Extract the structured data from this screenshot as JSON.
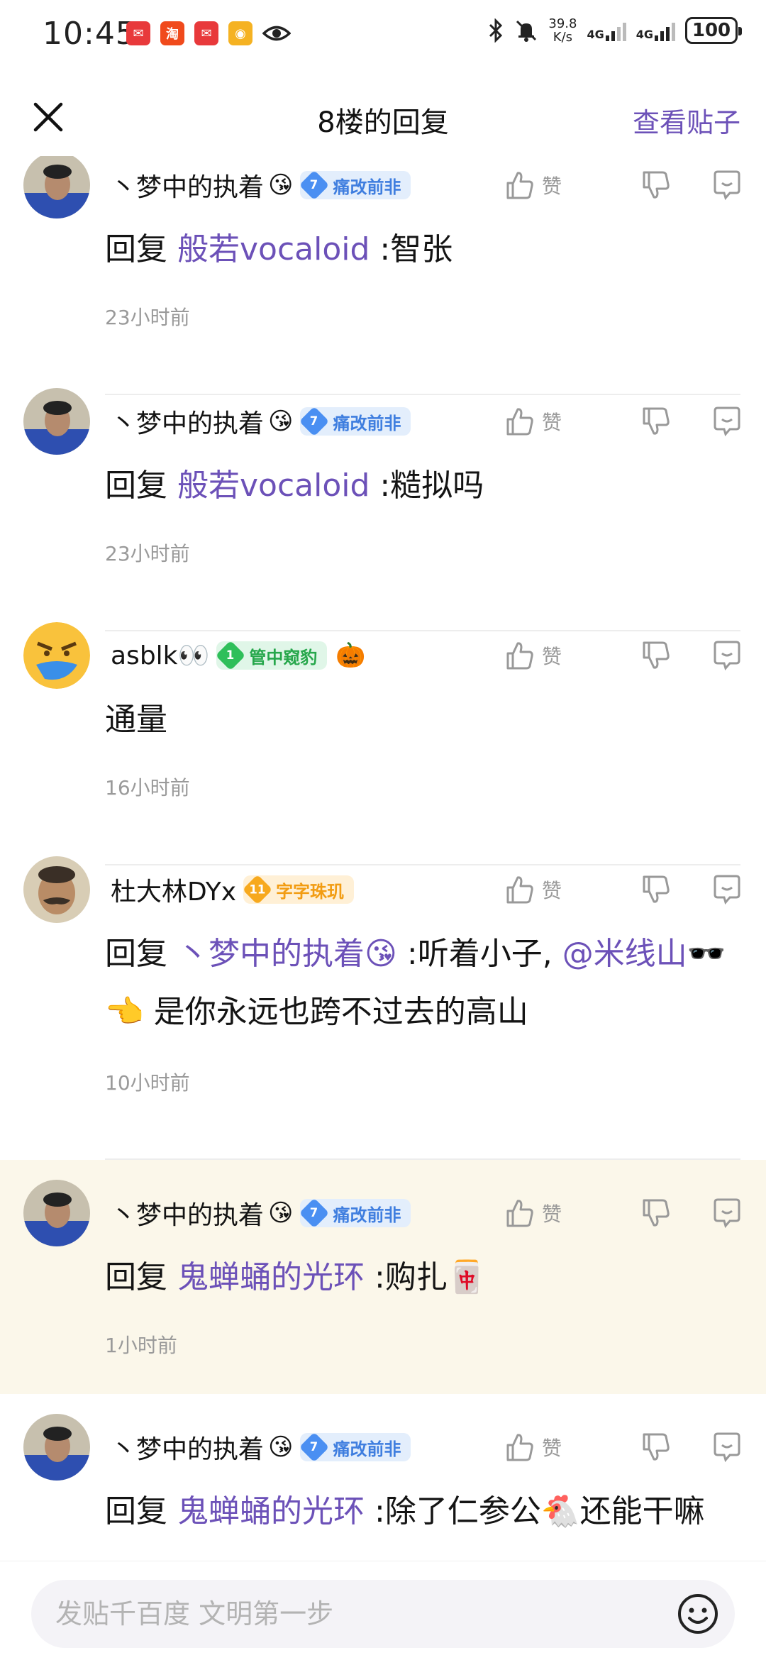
{
  "status_bar": {
    "time": "10:45",
    "net_speed_value": "39.8",
    "net_speed_unit": "K/s",
    "net1": "4G",
    "net2": "4G",
    "battery": "100"
  },
  "header": {
    "title": "8楼的回复",
    "view_post": "查看贴子"
  },
  "common": {
    "like": "赞"
  },
  "replies": [
    {
      "user": "丶梦中的执着",
      "user_emoji": "😘",
      "badge_level": "7",
      "badge_text": "痛改前非",
      "badge_color": "blue",
      "prefix": "回复",
      "mention": "般若vocaloid",
      "text": ":智张",
      "time": "23小时前"
    },
    {
      "user": "丶梦中的执着",
      "user_emoji": "😘",
      "badge_level": "7",
      "badge_text": "痛改前非",
      "badge_color": "blue",
      "prefix": "回复",
      "mention": "般若vocaloid",
      "text": ":糙拟吗",
      "time": "23小时前"
    },
    {
      "user": "asblk👀",
      "badge_level": "1",
      "badge_text": "管中窥豹",
      "badge_color": "green",
      "extra_emoji": "🎃",
      "text": "通量",
      "time": "16小时前"
    },
    {
      "user": "杜大林DYx",
      "badge_level": "11",
      "badge_text": "字字珠玑",
      "badge_color": "orange",
      "prefix": "回复",
      "mention": "丶梦中的执着😘",
      "text_part1": ":听着小子,",
      "mention2": "@米线山",
      "mention2_emoji": "🕶️👈",
      "text_part2": "是你永远也跨不过去的高山",
      "time": "10小时前"
    },
    {
      "user": "丶梦中的执着",
      "user_emoji": "😘",
      "badge_level": "7",
      "badge_text": "痛改前非",
      "badge_color": "blue",
      "prefix": "回复",
      "mention": "鬼蝉蛹的光环",
      "text": ":购扎🀄",
      "time": "1小时前"
    },
    {
      "user": "丶梦中的执着",
      "user_emoji": "😘",
      "badge_level": "7",
      "badge_text": "痛改前非",
      "badge_color": "blue",
      "prefix": "回复",
      "mention": "鬼蝉蛹的光环",
      "text": ":除了仁参公🐔还能干嘛"
    }
  ],
  "compose": {
    "placeholder": "发贴千百度 文明第一步"
  },
  "colors": {
    "accent": "#6c51b8",
    "highlight_bg": "#fbf7ea",
    "meta_text": "#9a9a9a"
  }
}
